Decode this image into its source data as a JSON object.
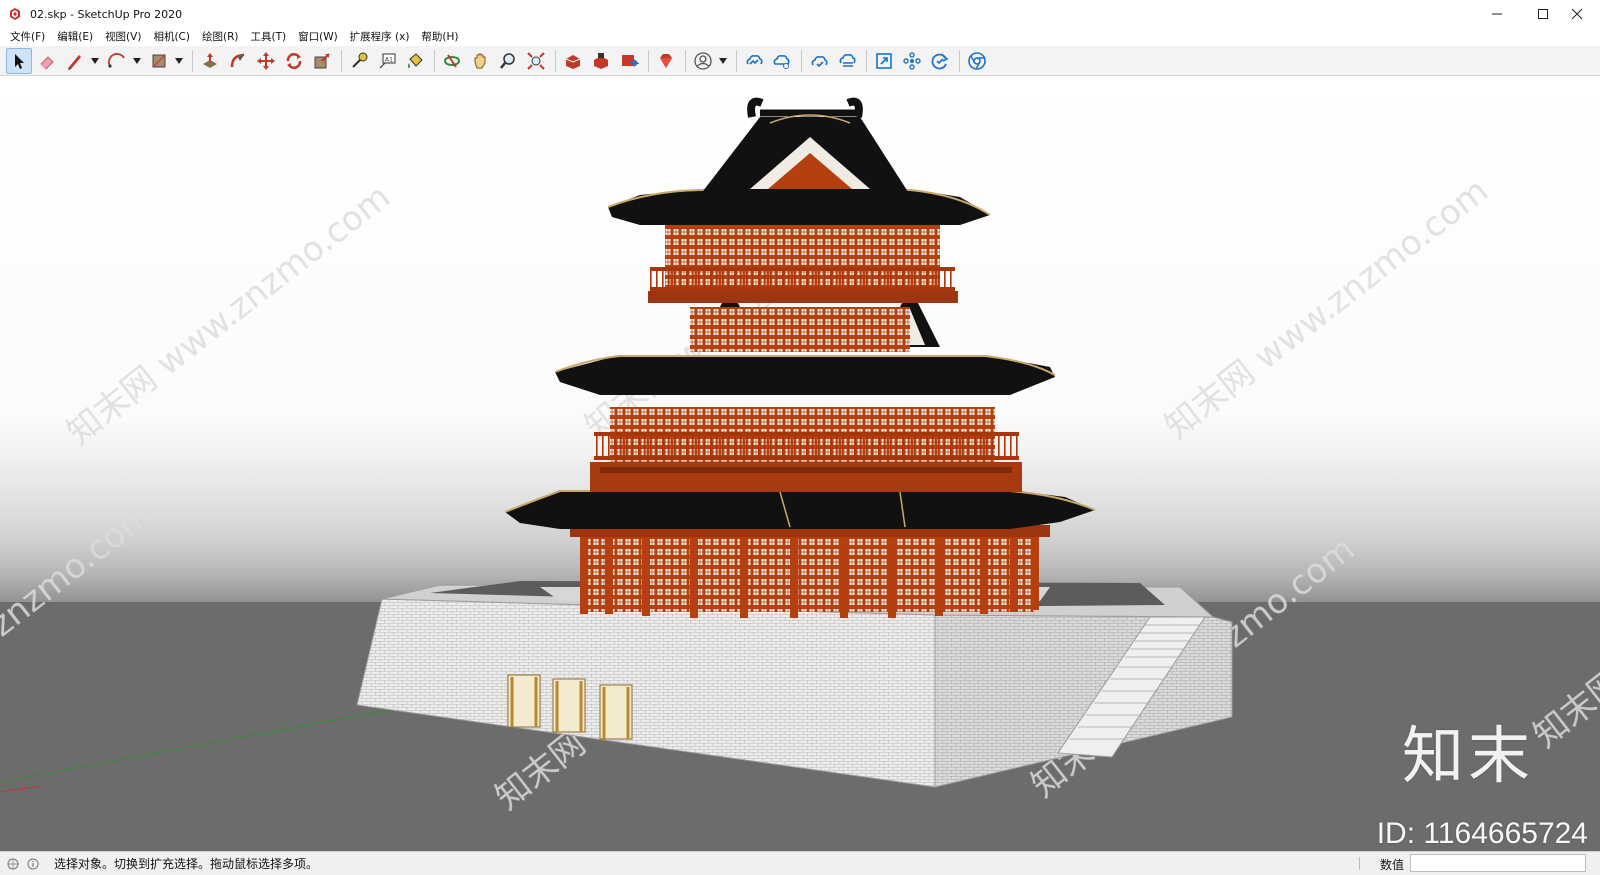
{
  "window": {
    "title": "02.skp - SketchUp Pro 2020",
    "controls": [
      "minimize",
      "maximize",
      "close"
    ]
  },
  "menu": {
    "items": [
      {
        "label": "文件(F)"
      },
      {
        "label": "编辑(E)"
      },
      {
        "label": "视图(V)"
      },
      {
        "label": "相机(C)"
      },
      {
        "label": "绘图(R)"
      },
      {
        "label": "工具(T)"
      },
      {
        "label": "窗口(W)"
      },
      {
        "label": "扩展程序 (x)"
      },
      {
        "label": "帮助(H)"
      }
    ]
  },
  "toolbar": {
    "tools": [
      {
        "name": "select-tool",
        "icon": "arrow-cursor-icon",
        "active": true
      },
      {
        "name": "eraser-tool",
        "icon": "eraser-icon"
      },
      {
        "name": "line-tool",
        "icon": "pencil-icon",
        "dropdown": true
      },
      {
        "name": "arc-tool",
        "icon": "arc-icon",
        "dropdown": true
      },
      {
        "name": "rectangle-tool",
        "icon": "rectangle-icon",
        "dropdown": true
      },
      {
        "name": "push-pull-tool",
        "icon": "push-pull-icon"
      },
      {
        "name": "follow-me-tool",
        "icon": "follow-me-icon"
      },
      {
        "name": "move-tool",
        "icon": "move-icon"
      },
      {
        "name": "rotate-tool",
        "icon": "rotate-icon"
      },
      {
        "name": "scale-tool",
        "icon": "scale-icon"
      },
      {
        "name": "tape-measure-tool",
        "icon": "tape-measure-icon"
      },
      {
        "name": "text-tool",
        "icon": "text-icon"
      },
      {
        "name": "paint-bucket-tool",
        "icon": "paint-bucket-icon"
      },
      {
        "name": "orbit-tool",
        "icon": "orbit-icon"
      },
      {
        "name": "pan-tool",
        "icon": "hand-icon"
      },
      {
        "name": "zoom-tool",
        "icon": "zoom-icon"
      },
      {
        "name": "zoom-extents-tool",
        "icon": "zoom-extents-icon"
      },
      {
        "name": "warehouse-tool",
        "icon": "warehouse-icon"
      },
      {
        "name": "extension-warehouse-tool",
        "icon": "extension-warehouse-icon"
      },
      {
        "name": "share-model-tool",
        "icon": "share-model-icon"
      },
      {
        "name": "ruby-tool",
        "icon": "ruby-gem-icon"
      },
      {
        "name": "account-tool",
        "icon": "account-icon",
        "dropdown": true
      },
      {
        "name": "trimble-connect-open",
        "icon": "cloud-link-icon"
      },
      {
        "name": "trimble-connect-share",
        "icon": "cloud-share-icon"
      },
      {
        "name": "trimble-connect-upload",
        "icon": "cloud-upload-icon"
      },
      {
        "name": "trimble-connect-sync",
        "icon": "cloud-sync-icon"
      },
      {
        "name": "add-location-tool",
        "icon": "location-frame-icon"
      },
      {
        "name": "components-tool",
        "icon": "components-icon"
      },
      {
        "name": "refresh-tool",
        "icon": "refresh-check-icon"
      },
      {
        "name": "chrome-tool",
        "icon": "chrome-icon"
      }
    ]
  },
  "viewport": {
    "watermarks": [
      "www.znzmo.com",
      "知末网",
      "znzmo.com"
    ],
    "brand": "知末",
    "id_text": "ID: 1164665724"
  },
  "status": {
    "text": "选择对象。切换到扩充选择。拖动鼠标选择多项。",
    "measure_label": "数值",
    "measure_value": ""
  },
  "colors": {
    "roof": "#111111",
    "timber": "#b5400f",
    "platform": "#e9e9e9",
    "ground": "#707070",
    "sky": "#ffffff",
    "accent": "#1a73c9"
  }
}
